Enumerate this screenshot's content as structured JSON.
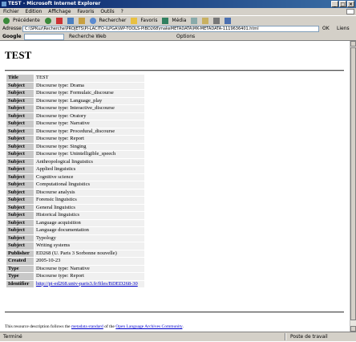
{
  "window": {
    "title": "TEST - Microsoft Internet Explorer",
    "buttons": [
      "_",
      "□",
      "×"
    ]
  },
  "menubar": {
    "items": [
      "Fichier",
      "Edition",
      "Affichage",
      "Favoris",
      "Outils",
      "?"
    ]
  },
  "toolbar": {
    "items": [
      "Précédente",
      "Rechercher",
      "Favoris",
      "Média"
    ]
  },
  "address": {
    "label": "Adresse",
    "value": "C:\\SPKuz\\Recherche\\PROJETS\\PI-LACITO-ILPGA\\WP-TOOLS-PIBD268\\makeMETADATA\\MK-METADATA-1119636401.html",
    "go_label": "OK",
    "links_label": "Liens"
  },
  "googlebar": {
    "logo": "Google",
    "search_label": "Recherche Web",
    "options_label": "Options"
  },
  "page": {
    "title": "TEST",
    "rows": [
      {
        "key": "Title",
        "value": "TEST"
      },
      {
        "key": "Subject",
        "value": "Discourse type: Drama"
      },
      {
        "key": "Subject",
        "value": "Discourse type: Formulaic_discourse"
      },
      {
        "key": "Subject",
        "value": "Discourse type: Language_play"
      },
      {
        "key": "Subject",
        "value": "Discourse type: Interactive_discourse"
      },
      {
        "key": "Subject",
        "value": "Discourse type: Oratory"
      },
      {
        "key": "Subject",
        "value": "Discourse type: Narrative"
      },
      {
        "key": "Subject",
        "value": "Discourse type: Procedural_discourse"
      },
      {
        "key": "Subject",
        "value": "Discourse type: Report"
      },
      {
        "key": "Subject",
        "value": "Discourse type: Singing"
      },
      {
        "key": "Subject",
        "value": "Discourse type: Unintelligible_speech"
      },
      {
        "key": "Subject",
        "value": "Anthropological linguistics"
      },
      {
        "key": "Subject",
        "value": "Applied linguistics"
      },
      {
        "key": "Subject",
        "value": "Cognitive science"
      },
      {
        "key": "Subject",
        "value": "Computational linguistics"
      },
      {
        "key": "Subject",
        "value": "Discourse analysis"
      },
      {
        "key": "Subject",
        "value": "Forensic linguistics"
      },
      {
        "key": "Subject",
        "value": "General linguistics"
      },
      {
        "key": "Subject",
        "value": "Historical linguistics"
      },
      {
        "key": "Subject",
        "value": "Language acquisition"
      },
      {
        "key": "Subject",
        "value": "Language documentation"
      },
      {
        "key": "Subject",
        "value": "Typology"
      },
      {
        "key": "Subject",
        "value": "Writing systems"
      },
      {
        "key": "Publisher",
        "value": "ED268 (U. Paris 3 Sorbonne nouvelle)"
      },
      {
        "key": "Created",
        "value": "2005-10-23"
      },
      {
        "key": "Type",
        "value": "Discourse type: Narrative"
      },
      {
        "key": "Type",
        "value": "Discourse type: Report"
      },
      {
        "key": "Identifier",
        "value": "http://pi-ed268.univ-paris3.fr/files/BDED268-30",
        "link": true
      }
    ],
    "footer": {
      "prefix": "This resource description follows the ",
      "link1": "metadata standard",
      "middle": " of the ",
      "link2": "Open Language Archives Community",
      "suffix": "."
    }
  },
  "statusbar": {
    "status": "Terminé",
    "zone": "Poste de travail"
  }
}
